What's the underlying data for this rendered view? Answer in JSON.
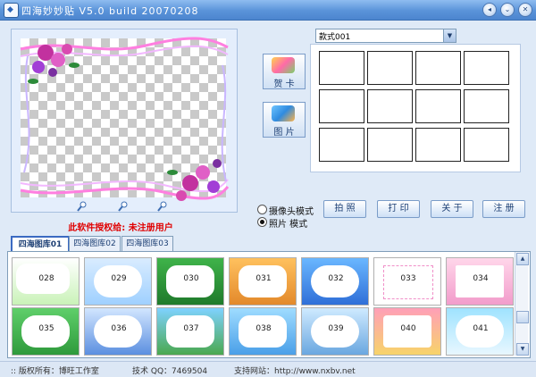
{
  "window": {
    "title": "四海妙妙贴 V5.0 build 20070208",
    "controls": [
      "◂",
      "⌄",
      "✕"
    ]
  },
  "side_buttons": {
    "greeting_card": "贺 卡",
    "picture": "图 片"
  },
  "style_select": {
    "value": "款式001"
  },
  "grid_cells": 12,
  "mode_options": [
    {
      "label": "摄像头模式",
      "selected": false
    },
    {
      "label": "照片  模式",
      "selected": true
    }
  ],
  "actions": {
    "shoot": "拍 照",
    "print": "打 印",
    "about": "关 于",
    "register": "注 册"
  },
  "license_text": "此软件授权给: 未注册用户",
  "tabs": [
    "四海图库01",
    "四海图库02",
    "四海图库03"
  ],
  "active_tab": 0,
  "library": {
    "row1": [
      "028",
      "029",
      "030",
      "031",
      "032",
      "033",
      "034"
    ],
    "row2": [
      "035",
      "036",
      "037",
      "038",
      "039",
      "040",
      "041"
    ]
  },
  "status": {
    "copyright": ":: 版权所有：博旺工作室",
    "qq": "技术 QQ：7469504",
    "website": "支持网站：http://www.nxbv.net"
  },
  "colors": {
    "title_bar": "#5a93d9",
    "window_bg": "#dfeaf7",
    "license_red": "#e00000",
    "tab_active_border": "#3b6ac2"
  }
}
